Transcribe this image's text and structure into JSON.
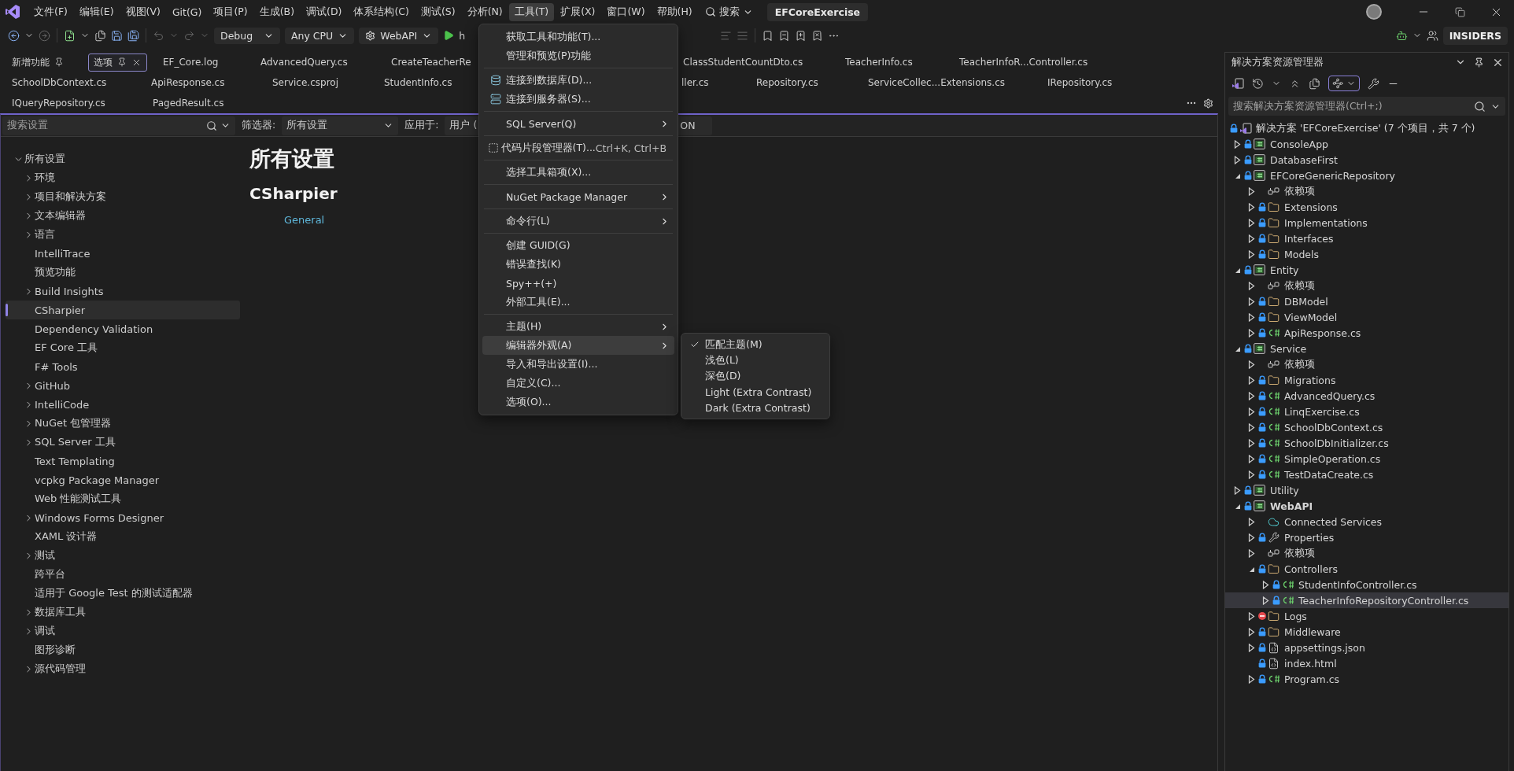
{
  "menu_bar": [
    {
      "label": "文件(F)",
      "selected": false
    },
    {
      "label": "编辑(E)",
      "selected": false
    },
    {
      "label": "视图(V)",
      "selected": false
    },
    {
      "label": "Git(G)",
      "selected": false
    },
    {
      "label": "项目(P)",
      "selected": false
    },
    {
      "label": "生成(B)",
      "selected": false
    },
    {
      "label": "调试(D)",
      "selected": false
    },
    {
      "label": "体系结构(C)",
      "selected": false
    },
    {
      "label": "测试(S)",
      "selected": false
    },
    {
      "label": "分析(N)",
      "selected": false
    },
    {
      "label": "工具(T)",
      "selected": true
    },
    {
      "label": "扩展(X)",
      "selected": false
    },
    {
      "label": "窗口(W)",
      "selected": false
    },
    {
      "label": "帮助(H)",
      "selected": false
    }
  ],
  "search": {
    "label": "搜索"
  },
  "window": {
    "title": "EFCoreExercise"
  },
  "toolbar": {
    "configuration": "Debug",
    "platform": "Any CPU",
    "startup_project": "WebAPI",
    "run_label": "h",
    "badge": "INSIDERS"
  },
  "tab_rows": [
    [
      {
        "label": "新增功能",
        "pinned": true,
        "selected": false
      },
      {
        "label": "选项",
        "pinned": true,
        "selected": true
      },
      {
        "label": "EF_Core.log",
        "pinned": false,
        "selected": false
      },
      {
        "label": "AdvancedQuery.cs",
        "pinned": false,
        "selected": false
      },
      {
        "label": "CreateTeacherRe",
        "pinned": false,
        "selected": false
      },
      {
        "label": "ClassStudentCountDto.cs",
        "pinned": false,
        "selected": false
      },
      {
        "label": "TeacherInfo.cs",
        "pinned": false,
        "selected": false
      },
      {
        "label": "TeacherInfoR...Controller.cs",
        "pinned": false,
        "selected": false
      }
    ],
    [
      {
        "label": "SchoolDbContext.cs",
        "pinned": false,
        "selected": false
      },
      {
        "label": "ApiResponse.cs",
        "pinned": false,
        "selected": false
      },
      {
        "label": "Service.csproj",
        "pinned": false,
        "selected": false
      },
      {
        "label": "StudentInfo.cs",
        "pinned": false,
        "selected": false
      },
      {
        "label": "ller.cs",
        "pinned": false,
        "selected": false
      },
      {
        "label": "Repository.cs",
        "pinned": false,
        "selected": false
      },
      {
        "label": "ServiceCollec...Extensions.cs",
        "pinned": false,
        "selected": false
      },
      {
        "label": "IRepository.cs",
        "pinned": false,
        "selected": false
      }
    ],
    [
      {
        "label": "IQueryRepository.cs",
        "pinned": false,
        "selected": false
      },
      {
        "label": "PagedResult.cs",
        "pinned": false,
        "selected": false
      }
    ]
  ],
  "settings": {
    "search_placeholder": "搜索设置",
    "filter_label": "筛选器:",
    "filter_value": "所有设置",
    "apply_label": "应用于:",
    "apply_value": "用户 (",
    "apply_value_tail": "ON"
  },
  "settings_tree": [
    {
      "label": "所有设置",
      "kind": "group",
      "expanded": true,
      "selected": false,
      "children": [
        {
          "label": "环境",
          "kind": "group",
          "expanded": false,
          "selected": false
        },
        {
          "label": "项目和解决方案",
          "kind": "group",
          "expanded": false,
          "selected": false
        },
        {
          "label": "文本编辑器",
          "kind": "group",
          "expanded": false,
          "selected": false
        },
        {
          "label": "语言",
          "kind": "group",
          "expanded": false,
          "selected": false
        },
        {
          "label": "IntelliTrace",
          "kind": "leaf",
          "selected": false
        },
        {
          "label": "预览功能",
          "kind": "leaf",
          "selected": false
        },
        {
          "label": "Build Insights",
          "kind": "group",
          "expanded": false,
          "selected": false
        },
        {
          "label": "CSharpier",
          "kind": "leaf",
          "selected": true
        },
        {
          "label": "Dependency Validation",
          "kind": "leaf",
          "selected": false
        },
        {
          "label": "EF Core 工具",
          "kind": "leaf",
          "selected": false
        },
        {
          "label": "F# Tools",
          "kind": "leaf",
          "selected": false
        },
        {
          "label": "GitHub",
          "kind": "group",
          "expanded": false,
          "selected": false
        },
        {
          "label": "IntelliCode",
          "kind": "group",
          "expanded": false,
          "selected": false
        },
        {
          "label": "NuGet 包管理器",
          "kind": "group",
          "expanded": false,
          "selected": false
        },
        {
          "label": "SQL Server 工具",
          "kind": "group",
          "expanded": false,
          "selected": false
        },
        {
          "label": "Text Templating",
          "kind": "leaf",
          "selected": false
        },
        {
          "label": "vcpkg Package Manager",
          "kind": "leaf",
          "selected": false
        },
        {
          "label": "Web 性能测试工具",
          "kind": "leaf",
          "selected": false
        },
        {
          "label": "Windows Forms Designer",
          "kind": "group",
          "expanded": false,
          "selected": false
        },
        {
          "label": "XAML 设计器",
          "kind": "leaf",
          "selected": false
        },
        {
          "label": "测试",
          "kind": "group",
          "expanded": false,
          "selected": false
        },
        {
          "label": "跨平台",
          "kind": "leaf",
          "selected": false
        },
        {
          "label": "适用于 Google Test 的测试适配器",
          "kind": "leaf",
          "selected": false
        },
        {
          "label": "数据库工具",
          "kind": "group",
          "expanded": false,
          "selected": false
        },
        {
          "label": "调试",
          "kind": "group",
          "expanded": false,
          "selected": false
        },
        {
          "label": "图形诊断",
          "kind": "leaf",
          "selected": false
        },
        {
          "label": "源代码管理",
          "kind": "group",
          "expanded": false,
          "selected": false
        }
      ]
    }
  ],
  "content": {
    "heading": "所有设置",
    "section": "CSharpier",
    "link": "General"
  },
  "tools_menu": [
    {
      "kind": "command",
      "label": "获取工具和功能(T)...",
      "selected": false
    },
    {
      "kind": "command",
      "label": "管理和预览(P)功能",
      "selected": false
    },
    {
      "kind": "separator"
    },
    {
      "kind": "command",
      "label": "连接到数据库(D)...",
      "selected": false
    },
    {
      "kind": "command",
      "label": "连接到服务器(S)...",
      "selected": false
    },
    {
      "kind": "separator"
    },
    {
      "kind": "submenu",
      "label": "SQL Server(Q)",
      "selected": false
    },
    {
      "kind": "separator"
    },
    {
      "kind": "command",
      "label": "代码片段管理器(T)...",
      "shortcut": "Ctrl+K, Ctrl+B",
      "selected": false
    },
    {
      "kind": "separator"
    },
    {
      "kind": "command",
      "label": "选择工具箱项(X)...",
      "selected": false
    },
    {
      "kind": "separator"
    },
    {
      "kind": "submenu",
      "label": "NuGet Package Manager",
      "selected": false
    },
    {
      "kind": "separator"
    },
    {
      "kind": "submenu",
      "label": "命令行(L)",
      "selected": false
    },
    {
      "kind": "separator"
    },
    {
      "kind": "command",
      "label": "创建 GUID(G)",
      "selected": false
    },
    {
      "kind": "command",
      "label": "错误查找(K)",
      "selected": false
    },
    {
      "kind": "command",
      "label": "Spy++(+)",
      "selected": false
    },
    {
      "kind": "command",
      "label": "外部工具(E)...",
      "selected": false
    },
    {
      "kind": "separator"
    },
    {
      "kind": "submenu",
      "label": "主题(H)",
      "selected": false
    },
    {
      "kind": "submenu",
      "label": "编辑器外观(A)",
      "selected": true,
      "children": [
        {
          "label": "匹配主题(M)",
          "checked": true
        },
        {
          "label": "浅色(L)",
          "checked": false
        },
        {
          "label": "深色(D)",
          "checked": false
        },
        {
          "label": "Light (Extra Contrast)",
          "checked": false
        },
        {
          "label": "Dark (Extra Contrast)",
          "checked": false
        }
      ]
    },
    {
      "kind": "command",
      "label": "导入和导出设置(I)...",
      "selected": false
    },
    {
      "kind": "command",
      "label": "自定义(C)...",
      "selected": false
    },
    {
      "kind": "command",
      "label": "选项(O)...",
      "selected": false
    }
  ],
  "solution_explorer": {
    "title": "解决方案资源管理器",
    "filter_toggle": {
      "selected": true
    },
    "search_placeholder": "搜索解决方案资源管理器(Ctrl+;)",
    "tree": [
      {
        "label": "解决方案 'EFCoreExercise' (7 个项目，共 7 个)",
        "kind": "solution",
        "selected": false,
        "children": [
          {
            "label": "ConsoleApp",
            "kind": "project",
            "expanded": false,
            "startup": false,
            "selected": false
          },
          {
            "label": "DatabaseFirst",
            "kind": "project",
            "expanded": false,
            "startup": false,
            "selected": false
          },
          {
            "label": "EFCoreGenericRepository",
            "kind": "project",
            "expanded": true,
            "startup": false,
            "selected": false,
            "children": [
              {
                "label": "依赖项",
                "kind": "dependencies",
                "expanded": false,
                "selected": false
              },
              {
                "label": "Extensions",
                "kind": "folder",
                "expanded": false,
                "selected": false
              },
              {
                "label": "Implementations",
                "kind": "folder",
                "expanded": false,
                "selected": false
              },
              {
                "label": "Interfaces",
                "kind": "folder",
                "expanded": false,
                "selected": false
              },
              {
                "label": "Models",
                "kind": "folder",
                "expanded": false,
                "selected": false
              }
            ]
          },
          {
            "label": "Entity",
            "kind": "project",
            "expanded": true,
            "startup": false,
            "selected": false,
            "children": [
              {
                "label": "依赖项",
                "kind": "dependencies",
                "expanded": false,
                "selected": false
              },
              {
                "label": "DBModel",
                "kind": "folder",
                "expanded": false,
                "selected": false
              },
              {
                "label": "ViewModel",
                "kind": "folder",
                "expanded": false,
                "selected": false
              },
              {
                "label": "ApiResponse.cs",
                "kind": "csharp",
                "expanded": false,
                "selected": false
              }
            ]
          },
          {
            "label": "Service",
            "kind": "project",
            "expanded": true,
            "startup": false,
            "selected": false,
            "children": [
              {
                "label": "依赖项",
                "kind": "dependencies",
                "expanded": false,
                "selected": false
              },
              {
                "label": "Migrations",
                "kind": "folder",
                "expanded": false,
                "selected": false
              },
              {
                "label": "AdvancedQuery.cs",
                "kind": "csharp",
                "expanded": false,
                "selected": false
              },
              {
                "label": "LinqExercise.cs",
                "kind": "csharp",
                "expanded": false,
                "selected": false
              },
              {
                "label": "SchoolDbContext.cs",
                "kind": "csharp",
                "expanded": false,
                "selected": false
              },
              {
                "label": "SchoolDbInitializer.cs",
                "kind": "csharp",
                "expanded": false,
                "selected": false
              },
              {
                "label": "SimpleOperation.cs",
                "kind": "csharp",
                "expanded": false,
                "selected": false
              },
              {
                "label": "TestDataCreate.cs",
                "kind": "csharp",
                "expanded": false,
                "selected": false
              }
            ]
          },
          {
            "label": "Utility",
            "kind": "project",
            "expanded": false,
            "startup": false,
            "selected": false
          },
          {
            "label": "WebAPI",
            "kind": "project",
            "expanded": true,
            "startup": true,
            "selected": false,
            "children": [
              {
                "label": "Connected Services",
                "kind": "connected",
                "expanded": false,
                "selected": false
              },
              {
                "label": "Properties",
                "kind": "properties",
                "expanded": false,
                "selected": false
              },
              {
                "label": "依赖项",
                "kind": "dependencies",
                "expanded": false,
                "selected": false
              },
              {
                "label": "Controllers",
                "kind": "folder",
                "expanded": true,
                "selected": false,
                "children": [
                  {
                    "label": "StudentInfoController.cs",
                    "kind": "csharp",
                    "expanded": false,
                    "selected": false
                  },
                  {
                    "label": "TeacherInfoRepositoryController.cs",
                    "kind": "csharp",
                    "expanded": false,
                    "selected": true
                  }
                ]
              },
              {
                "label": "Logs",
                "kind": "excluded_folder",
                "expanded": false,
                "selected": false
              },
              {
                "label": "Middleware",
                "kind": "folder",
                "expanded": false,
                "selected": false
              },
              {
                "label": "appsettings.json",
                "kind": "json",
                "expanded": false,
                "selected": false
              },
              {
                "label": "index.html",
                "kind": "html",
                "selected": false
              },
              {
                "label": "Program.cs",
                "kind": "csharp",
                "expanded": false,
                "selected": false
              }
            ]
          }
        ]
      }
    ]
  }
}
